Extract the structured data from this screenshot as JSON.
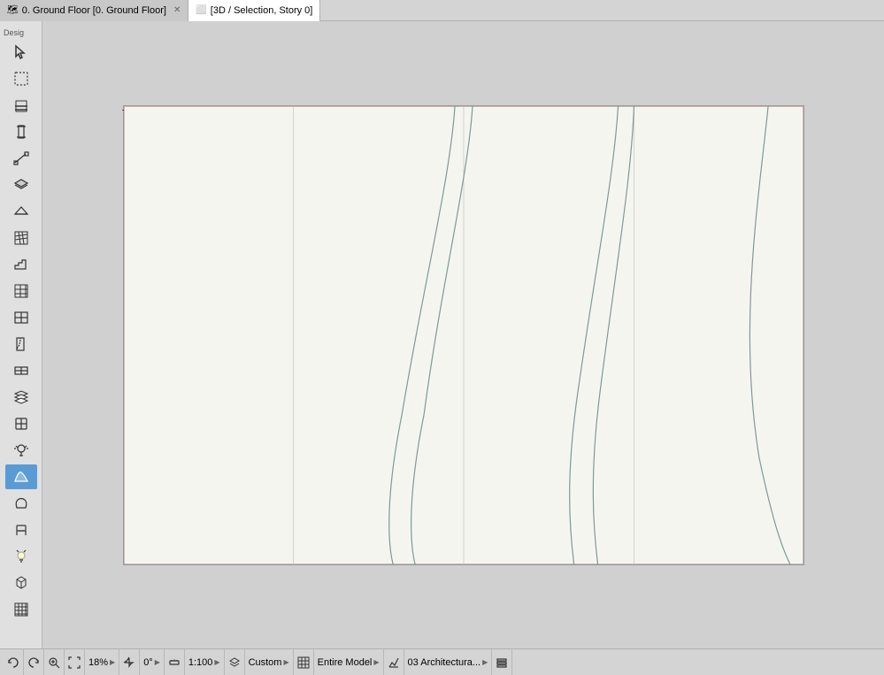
{
  "tabs": [
    {
      "id": "ground-floor",
      "icon": "floor-plan-icon",
      "label": "0. Ground Floor [0. Ground Floor]",
      "closeable": true,
      "active": false
    },
    {
      "id": "3d-selection",
      "icon": "3d-icon",
      "label": "[3D / Selection, Story 0]",
      "closeable": false,
      "active": true
    }
  ],
  "toolbar": {
    "section_label": "Desig",
    "tools": [
      {
        "name": "select-tool",
        "active": false
      },
      {
        "name": "marquee-tool",
        "active": false
      },
      {
        "name": "wall-tool",
        "active": false
      },
      {
        "name": "column-tool",
        "active": false
      },
      {
        "name": "beam-tool",
        "active": false
      },
      {
        "name": "slab-tool",
        "active": false
      },
      {
        "name": "roof-tool",
        "active": false
      },
      {
        "name": "mesh-tool",
        "active": false
      },
      {
        "name": "stair-tool",
        "active": false
      },
      {
        "name": "grid-tool",
        "active": false
      },
      {
        "name": "curtain-wall-tool",
        "active": false
      },
      {
        "name": "door-tool",
        "active": false
      },
      {
        "name": "window-tool",
        "active": false
      },
      {
        "name": "skylight-tool",
        "active": false
      },
      {
        "name": "object-tool",
        "active": false
      },
      {
        "name": "lamp-tool",
        "active": false
      },
      {
        "name": "shell-tool",
        "active": true
      },
      {
        "name": "morph-tool",
        "active": false
      },
      {
        "name": "chair-tool",
        "active": false
      },
      {
        "name": "light-tool",
        "active": false
      },
      {
        "name": "3d-object-tool",
        "active": false
      },
      {
        "name": "grid-snap-tool",
        "active": false
      }
    ]
  },
  "status_bar": {
    "undo_icon": "undo-icon",
    "redo_icon": "redo-icon",
    "zoom_in_icon": "zoom-in-icon",
    "fit_icon": "fit-icon",
    "zoom_value": "18%",
    "zoom_arrow": "▶",
    "pan_icon": "pan-icon",
    "angle_value": "0°",
    "angle_arrow": "▶",
    "measure_icon": "measure-icon",
    "scale_value": "1:100",
    "scale_arrow": "▶",
    "layer_icon": "layer-icon",
    "custom_label": "Custom",
    "custom_arrow": "▶",
    "grid_icon": "grid-icon",
    "model_scope": "Entire Model",
    "model_arrow": "▶",
    "tracker_icon": "tracker-icon",
    "building_layer": "03 Architectura...",
    "building_arrow": "▶",
    "options_icon": "options-icon"
  }
}
